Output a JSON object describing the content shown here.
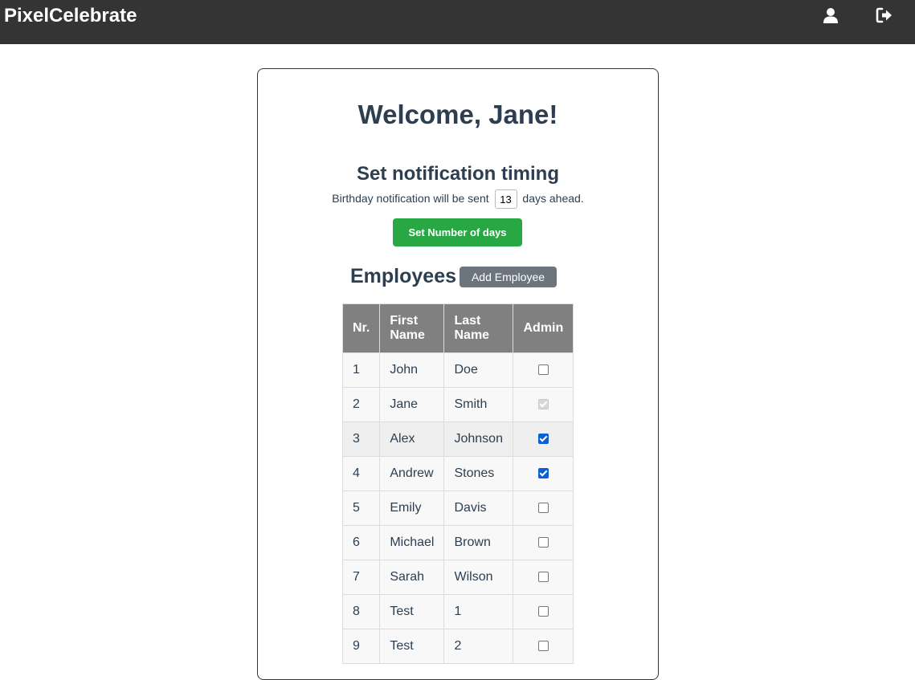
{
  "header": {
    "brand": "PixelCelebrate",
    "icons": [
      "user-icon",
      "logout-icon"
    ],
    "bg_color": "#343434"
  },
  "main": {
    "welcome": "Welcome, Jane!",
    "notification": {
      "title": "Set notification timing",
      "text_before": "Birthday notification will be sent",
      "days_value": "13",
      "text_after": "days ahead.",
      "set_button_label": "Set Number of days",
      "set_button_color": "#28a745"
    },
    "employees": {
      "title": "Employees",
      "add_button_label": "Add Employee",
      "columns": [
        "Nr.",
        "First Name",
        "Last Name",
        "Admin"
      ],
      "rows": [
        {
          "nr": "1",
          "first": "John",
          "last": "Doe",
          "admin": false
        },
        {
          "nr": "2",
          "first": "Jane",
          "last": "Smith",
          "admin": true,
          "disabled": true
        },
        {
          "nr": "3",
          "first": "Alex",
          "last": "Johnson",
          "admin": true,
          "hover": true
        },
        {
          "nr": "4",
          "first": "Andrew",
          "last": "Stones",
          "admin": true
        },
        {
          "nr": "5",
          "first": "Emily",
          "last": "Davis",
          "admin": false
        },
        {
          "nr": "6",
          "first": "Michael",
          "last": "Brown",
          "admin": false
        },
        {
          "nr": "7",
          "first": "Sarah",
          "last": "Wilson",
          "admin": false
        },
        {
          "nr": "8",
          "first": "Test",
          "last": "1",
          "admin": false
        },
        {
          "nr": "9",
          "first": "Test",
          "last": "2",
          "admin": false
        }
      ]
    }
  }
}
